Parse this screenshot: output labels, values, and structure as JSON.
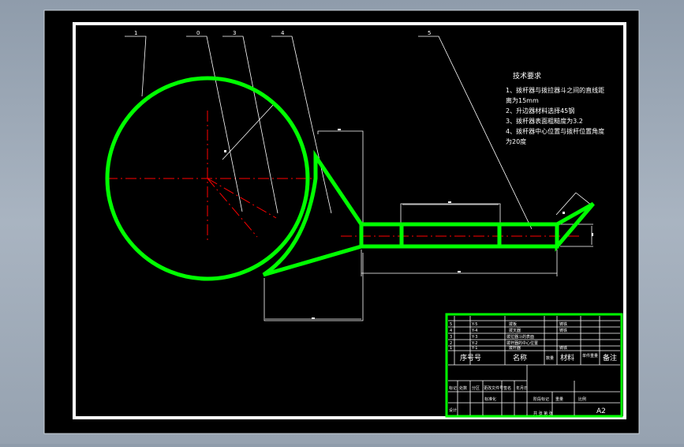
{
  "colors": {
    "background": "#000000",
    "border": "#ffffff",
    "outline": "#00ff00",
    "centerline": "#ff0000",
    "leader": "#ffffff",
    "surround": "#9aa6b4"
  },
  "balloons": [
    "1",
    "0",
    "3",
    "4",
    "5"
  ],
  "tech_requirements": {
    "title": "技术要求",
    "items": [
      "1、拨杆器与拨拉器斗之间的直线距",
      "离为15mm",
      "2、升边器材料选择45钢",
      "3、拨杆器表面粗糙度为3.2",
      "4、拨杆器中心位置与拨杆位置角度",
      "为20度"
    ]
  },
  "title_block": {
    "parts": [
      {
        "no": "5",
        "code": "Y-5",
        "name": "拨板",
        "material": "铸铁"
      },
      {
        "no": "4",
        "code": "Y-4",
        "name": "拨叉器",
        "material": "铸铁"
      },
      {
        "no": "3",
        "code": "Y-3",
        "name": "拨拉器斗的表面",
        "material": ""
      },
      {
        "no": "2",
        "code": "Y-2",
        "name": "拨杆器的中心位置",
        "material": ""
      },
      {
        "no": "1",
        "code": "Y-1",
        "name": "拨杆器",
        "material": "铸铁"
      }
    ],
    "header": {
      "no": "序号",
      "code": "号",
      "name": "名称",
      "qty": "数量",
      "material": "材料",
      "weight": "单件重量",
      "notes": "备注"
    },
    "label_mark": "标记",
    "label_count": "处数",
    "label_zone": "分区",
    "label_change_doc": "更改文件号",
    "label_sign": "签名",
    "label_date": "年月日",
    "label_design": "设计",
    "label_standard": "标准化",
    "label_stage_mark": "阶段标记",
    "label_weight": "重量",
    "label_scale": "比例",
    "label_sheet": "共 张 第 张",
    "sheet_size": "A2"
  }
}
